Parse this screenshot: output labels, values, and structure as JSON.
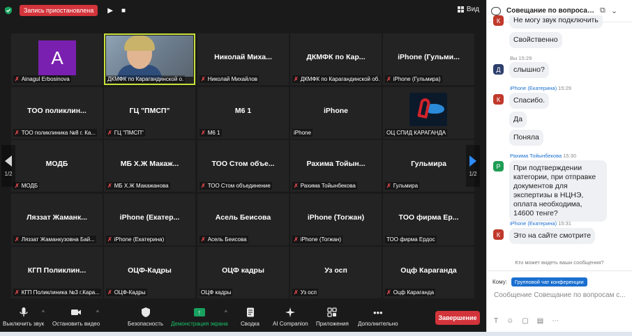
{
  "topbar": {
    "recording_label": "Запись приостановлена",
    "play_glyph": "▶",
    "stop_glyph": "■",
    "view_label": "Вид"
  },
  "tiles": [
    {
      "center": "",
      "label": "Ainagul Erbosinova",
      "avatar_letter": "A",
      "kind": "avatar",
      "muted": true
    },
    {
      "center": "",
      "label": "ДКМФК по Карагандинской о.",
      "kind": "video",
      "muted": false,
      "active": true
    },
    {
      "center": "Николай Миха...",
      "label": "Николай Михайлов",
      "kind": "name",
      "muted": true
    },
    {
      "center": "ДКМФК по Кар...",
      "label": "ДКМФК по Карагандинской об.",
      "kind": "name",
      "muted": true
    },
    {
      "center": "iPhone (Гульми...",
      "label": "iPhone (Гульмира)",
      "kind": "name",
      "muted": true
    },
    {
      "center": "ТОО поликлин...",
      "label": "ТОО поликлиника №8 г. Ка...",
      "kind": "name",
      "muted": true
    },
    {
      "center": "ГЦ \"ПМСП\"",
      "label": "ГЦ \"ПМСП\"",
      "kind": "name",
      "muted": true
    },
    {
      "center": "М6 1",
      "label": "М6 1",
      "kind": "name",
      "muted": true
    },
    {
      "center": "iPhone",
      "label": "iPhone",
      "kind": "name",
      "muted": false
    },
    {
      "center": "",
      "label": "ОЦ СПИД КАРАГАНДА",
      "kind": "logo",
      "muted": false
    },
    {
      "center": "МОДБ",
      "label": "МОДБ",
      "kind": "name",
      "muted": true
    },
    {
      "center": "МБ Х.Ж Макаж...",
      "label": "МБ Х.Ж Макажанова",
      "kind": "name",
      "muted": true
    },
    {
      "center": "ТОО Стом объе...",
      "label": "ТОО Стом объединение",
      "kind": "name",
      "muted": true
    },
    {
      "center": "Рахима Тойын...",
      "label": "Рахима Тойынбекова",
      "kind": "name",
      "muted": true
    },
    {
      "center": "Гульмира",
      "label": "Гульмира",
      "kind": "name",
      "muted": true
    },
    {
      "center": "Ляззат Жаманк...",
      "label": "Ляззат Жаманкузовна Бай...",
      "kind": "name",
      "muted": true
    },
    {
      "center": "iPhone (Екатер...",
      "label": "iPhone (Екатерина)",
      "kind": "name",
      "muted": true
    },
    {
      "center": "Асель Беисова",
      "label": "Асель Беисова",
      "kind": "name",
      "muted": true
    },
    {
      "center": "iPhone (Тогжан)",
      "label": "iPhone (Тогжан)",
      "kind": "name",
      "muted": true
    },
    {
      "center": "ТОО фирма Ер...",
      "label": "ТОО фирма Ердос",
      "kind": "name",
      "muted": false
    },
    {
      "center": "КГП Поликлин...",
      "label": "КГП Поликлиника №3 г.Кара...",
      "kind": "name",
      "muted": true
    },
    {
      "center": "ОЦФ-Кадры",
      "label": "ОЦФ-Кадры",
      "kind": "name",
      "muted": true
    },
    {
      "center": "ОЦФ кадры",
      "label": "ОЦФ кадры",
      "kind": "name",
      "muted": false
    },
    {
      "center": "Уз осп",
      "label": "Уз осп",
      "kind": "name",
      "muted": true
    },
    {
      "center": "Оцф Караганда",
      "label": "Оцф Караганда",
      "kind": "name",
      "muted": true
    }
  ],
  "pagination": {
    "left": "1/2",
    "right": "1/2"
  },
  "toolbar": {
    "mute": "Выключить звук",
    "video": "Остановить видео",
    "security": "Безопасность",
    "share": "Демонстрация экрана",
    "summary": "Сводка",
    "ai": "AI Companion",
    "apps": "Приложения",
    "more": "Дополнительно",
    "end": "Завершение"
  },
  "chat": {
    "title": "Совещание по вопросам ...",
    "messages": {
      "m1": "Не могу звук подключить",
      "m2": "Свойственно",
      "m3_meta": "Вы 15:29",
      "m3": "слышно?",
      "m4_sender": "iPhone (Екатерина)",
      "m4_time": "15:29",
      "m4": "Спасибо.",
      "m5": "Да",
      "m6": "Поняла",
      "m7_sender": "Рахима Тойынбекова",
      "m7_time": "15:30",
      "m7": "При подтверждении категории, при отправке документов для экспертизы в НЦНЭ, оплата необходима, 14600 тенге?",
      "m8_sender": "iPhone (Екатерина)",
      "m8_time": "15:31",
      "m8": "Это на сайте смотрите"
    },
    "avatars": {
      "k": "К",
      "d": "Д",
      "r": "Р"
    },
    "who_can_see": "Кто может видеть ваши сообщения?",
    "to_label": "Кому:",
    "to_value": "Групповой чат конференции",
    "input_placeholder": "Сообщение Совещание по вопросам с..."
  },
  "colors": {
    "accent_green": "#19a15f",
    "end_red": "#d3343b",
    "link_blue": "#1a6fd0",
    "avatar_purple": "#7a20b0"
  }
}
